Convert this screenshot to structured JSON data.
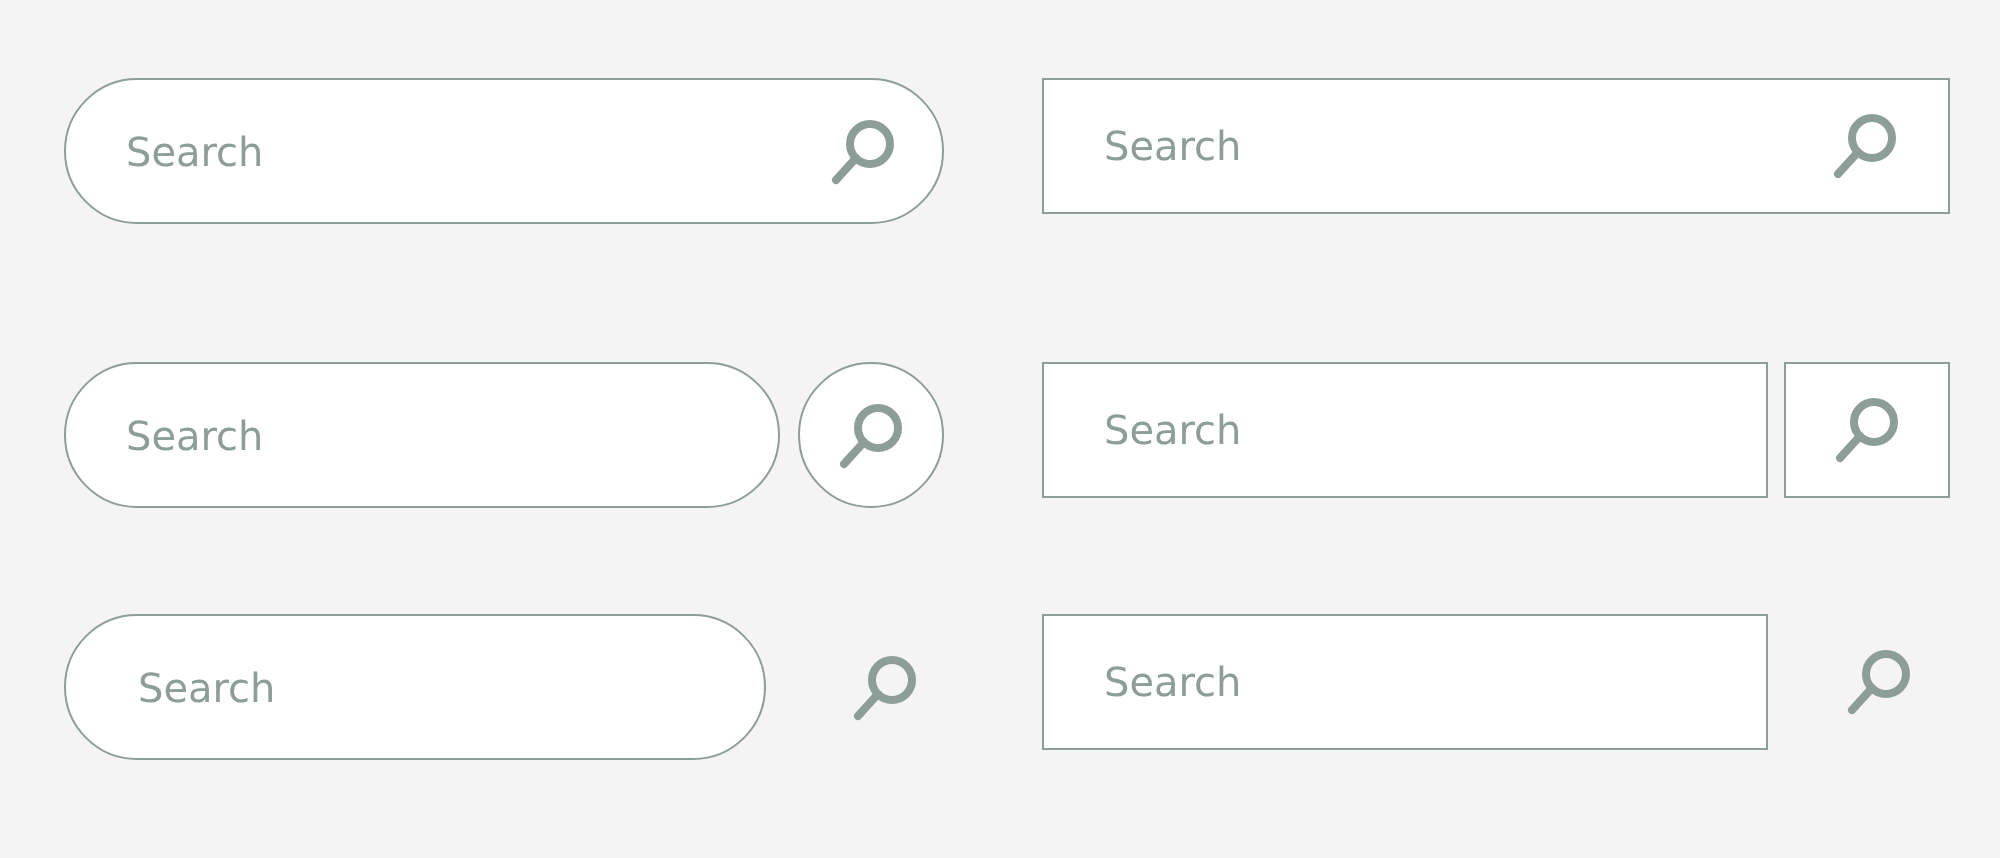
{
  "search_bars": [
    {
      "kind": "pill",
      "icon_inside": true,
      "icon_boxed": false,
      "placeholder": "Search"
    },
    {
      "kind": "rect",
      "icon_inside": true,
      "icon_boxed": false,
      "placeholder": "Search"
    },
    {
      "kind": "pill",
      "icon_inside": false,
      "icon_boxed": true,
      "placeholder": "Search"
    },
    {
      "kind": "rect",
      "icon_inside": false,
      "icon_boxed": true,
      "placeholder": "Search"
    },
    {
      "kind": "pill",
      "icon_inside": false,
      "icon_boxed": false,
      "placeholder": "Search"
    },
    {
      "kind": "rect",
      "icon_inside": false,
      "icon_boxed": false,
      "placeholder": "Search"
    }
  ]
}
